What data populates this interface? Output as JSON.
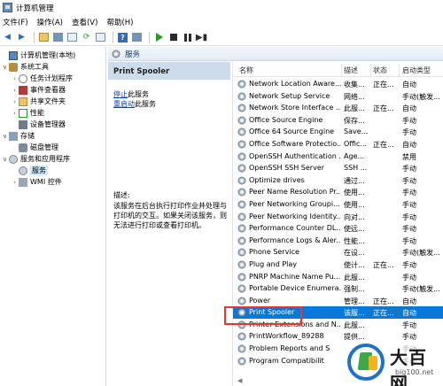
{
  "window": {
    "title": "计算机管理"
  },
  "menu": [
    "文件(F)",
    "操作(A)",
    "查看(V)",
    "帮助(H)"
  ],
  "tree": {
    "root": "计算机管理(本地)",
    "system_tools": "系统工具",
    "task_scheduler": "任务计划程序",
    "event_viewer": "事件查看器",
    "shared_folders": "共享文件夹",
    "performance": "性能",
    "device_manager": "设备管理器",
    "storage": "存储",
    "disk_management": "磁盘管理",
    "services_apps": "服务和应用程序",
    "services": "服务",
    "wmi": "WMI 控件"
  },
  "header": {
    "title": "服务"
  },
  "detail": {
    "service_name": "Print Spooler",
    "stop_link": "停止",
    "stop_suffix": "此服务",
    "restart_link": "重启动",
    "restart_suffix": "此服务",
    "desc_label": "描述:",
    "description": "该服务在后台执行打印作业并处理与打印机的交互。如果关闭该服务，则无法进行打印或查看打印机。"
  },
  "columns": {
    "name": "名称",
    "desc": "描述",
    "state": "状态",
    "startup": "启动类型"
  },
  "services": [
    {
      "name": "Network Location Aware...",
      "desc": "收集...",
      "state": "正在...",
      "startup": "自动"
    },
    {
      "name": "Network Setup Service",
      "desc": "网络...",
      "state": "",
      "startup": "手动(触发..."
    },
    {
      "name": "Network Store Interface ...",
      "desc": "此服...",
      "state": "正在...",
      "startup": "自动"
    },
    {
      "name": "Office  Source Engine",
      "desc": "保存...",
      "state": "",
      "startup": "手动"
    },
    {
      "name": "Office 64 Source Engine",
      "desc": "Save...",
      "state": "",
      "startup": "手动"
    },
    {
      "name": "Office Software Protectio...",
      "desc": "Offic...",
      "state": "正在...",
      "startup": "自动"
    },
    {
      "name": "OpenSSH Authentication ...",
      "desc": "Age...",
      "state": "",
      "startup": "禁用"
    },
    {
      "name": "OpenSSH SSH Server",
      "desc": "SSH ...",
      "state": "",
      "startup": "手动"
    },
    {
      "name": "Optimize drives",
      "desc": "通过...",
      "state": "",
      "startup": "手动"
    },
    {
      "name": "Peer Name Resolution Pr...",
      "desc": "使用...",
      "state": "",
      "startup": "手动"
    },
    {
      "name": "Peer Networking Groupi...",
      "desc": "使用...",
      "state": "",
      "startup": "手动"
    },
    {
      "name": "Peer Networking Identity...",
      "desc": "向对...",
      "state": "",
      "startup": "手动"
    },
    {
      "name": "Performance Counter DL...",
      "desc": "使远...",
      "state": "",
      "startup": "手动"
    },
    {
      "name": "Performance Logs & Aler...",
      "desc": "性能...",
      "state": "",
      "startup": "手动"
    },
    {
      "name": "Phone Service",
      "desc": "在设...",
      "state": "",
      "startup": "手动(触发..."
    },
    {
      "name": "Plug and Play",
      "desc": "使计...",
      "state": "正在...",
      "startup": "手动"
    },
    {
      "name": "PNRP Machine Name Pu...",
      "desc": "此服...",
      "state": "",
      "startup": "手动"
    },
    {
      "name": "Portable Device Enumera...",
      "desc": "强制...",
      "state": "",
      "startup": "手动(触发..."
    },
    {
      "name": "Power",
      "desc": "管理...",
      "state": "正在...",
      "startup": "自动"
    },
    {
      "name": "Print Spooler",
      "desc": "该服...",
      "state": "正在...",
      "startup": "自动",
      "selected": true
    },
    {
      "name": "Printer Extensions and N...",
      "desc": "此服...",
      "state": "",
      "startup": "手动"
    },
    {
      "name": "PrintWorkflow_89288",
      "desc": "提供...",
      "state": "",
      "startup": "手动"
    },
    {
      "name": "Problem Reports and S",
      "desc": "",
      "state": "",
      "startup": "手动"
    },
    {
      "name": "Program Compatibilit",
      "desc": "",
      "state": "",
      "startup": "手动"
    }
  ],
  "watermark": {
    "text": "大百网",
    "url": "big100.net"
  },
  "colors": {
    "selection": "#0a78d7",
    "highlight_box": "#e8362f",
    "link": "#0645ad"
  }
}
